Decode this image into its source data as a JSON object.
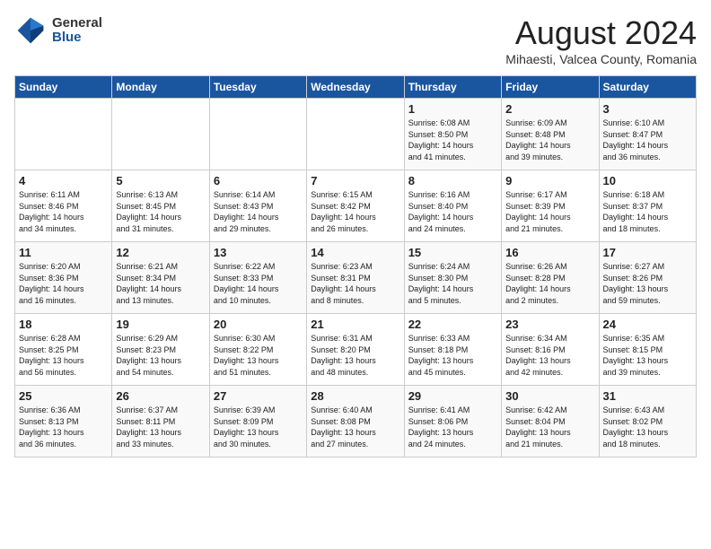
{
  "logo": {
    "general": "General",
    "blue": "Blue"
  },
  "title": {
    "month_year": "August 2024",
    "location": "Mihaesti, Valcea County, Romania"
  },
  "days_of_week": [
    "Sunday",
    "Monday",
    "Tuesday",
    "Wednesday",
    "Thursday",
    "Friday",
    "Saturday"
  ],
  "weeks": [
    [
      {
        "day": "",
        "info": ""
      },
      {
        "day": "",
        "info": ""
      },
      {
        "day": "",
        "info": ""
      },
      {
        "day": "",
        "info": ""
      },
      {
        "day": "1",
        "info": "Sunrise: 6:08 AM\nSunset: 8:50 PM\nDaylight: 14 hours\nand 41 minutes."
      },
      {
        "day": "2",
        "info": "Sunrise: 6:09 AM\nSunset: 8:48 PM\nDaylight: 14 hours\nand 39 minutes."
      },
      {
        "day": "3",
        "info": "Sunrise: 6:10 AM\nSunset: 8:47 PM\nDaylight: 14 hours\nand 36 minutes."
      }
    ],
    [
      {
        "day": "4",
        "info": "Sunrise: 6:11 AM\nSunset: 8:46 PM\nDaylight: 14 hours\nand 34 minutes."
      },
      {
        "day": "5",
        "info": "Sunrise: 6:13 AM\nSunset: 8:45 PM\nDaylight: 14 hours\nand 31 minutes."
      },
      {
        "day": "6",
        "info": "Sunrise: 6:14 AM\nSunset: 8:43 PM\nDaylight: 14 hours\nand 29 minutes."
      },
      {
        "day": "7",
        "info": "Sunrise: 6:15 AM\nSunset: 8:42 PM\nDaylight: 14 hours\nand 26 minutes."
      },
      {
        "day": "8",
        "info": "Sunrise: 6:16 AM\nSunset: 8:40 PM\nDaylight: 14 hours\nand 24 minutes."
      },
      {
        "day": "9",
        "info": "Sunrise: 6:17 AM\nSunset: 8:39 PM\nDaylight: 14 hours\nand 21 minutes."
      },
      {
        "day": "10",
        "info": "Sunrise: 6:18 AM\nSunset: 8:37 PM\nDaylight: 14 hours\nand 18 minutes."
      }
    ],
    [
      {
        "day": "11",
        "info": "Sunrise: 6:20 AM\nSunset: 8:36 PM\nDaylight: 14 hours\nand 16 minutes."
      },
      {
        "day": "12",
        "info": "Sunrise: 6:21 AM\nSunset: 8:34 PM\nDaylight: 14 hours\nand 13 minutes."
      },
      {
        "day": "13",
        "info": "Sunrise: 6:22 AM\nSunset: 8:33 PM\nDaylight: 14 hours\nand 10 minutes."
      },
      {
        "day": "14",
        "info": "Sunrise: 6:23 AM\nSunset: 8:31 PM\nDaylight: 14 hours\nand 8 minutes."
      },
      {
        "day": "15",
        "info": "Sunrise: 6:24 AM\nSunset: 8:30 PM\nDaylight: 14 hours\nand 5 minutes."
      },
      {
        "day": "16",
        "info": "Sunrise: 6:26 AM\nSunset: 8:28 PM\nDaylight: 14 hours\nand 2 minutes."
      },
      {
        "day": "17",
        "info": "Sunrise: 6:27 AM\nSunset: 8:26 PM\nDaylight: 13 hours\nand 59 minutes."
      }
    ],
    [
      {
        "day": "18",
        "info": "Sunrise: 6:28 AM\nSunset: 8:25 PM\nDaylight: 13 hours\nand 56 minutes."
      },
      {
        "day": "19",
        "info": "Sunrise: 6:29 AM\nSunset: 8:23 PM\nDaylight: 13 hours\nand 54 minutes."
      },
      {
        "day": "20",
        "info": "Sunrise: 6:30 AM\nSunset: 8:22 PM\nDaylight: 13 hours\nand 51 minutes."
      },
      {
        "day": "21",
        "info": "Sunrise: 6:31 AM\nSunset: 8:20 PM\nDaylight: 13 hours\nand 48 minutes."
      },
      {
        "day": "22",
        "info": "Sunrise: 6:33 AM\nSunset: 8:18 PM\nDaylight: 13 hours\nand 45 minutes."
      },
      {
        "day": "23",
        "info": "Sunrise: 6:34 AM\nSunset: 8:16 PM\nDaylight: 13 hours\nand 42 minutes."
      },
      {
        "day": "24",
        "info": "Sunrise: 6:35 AM\nSunset: 8:15 PM\nDaylight: 13 hours\nand 39 minutes."
      }
    ],
    [
      {
        "day": "25",
        "info": "Sunrise: 6:36 AM\nSunset: 8:13 PM\nDaylight: 13 hours\nand 36 minutes."
      },
      {
        "day": "26",
        "info": "Sunrise: 6:37 AM\nSunset: 8:11 PM\nDaylight: 13 hours\nand 33 minutes."
      },
      {
        "day": "27",
        "info": "Sunrise: 6:39 AM\nSunset: 8:09 PM\nDaylight: 13 hours\nand 30 minutes."
      },
      {
        "day": "28",
        "info": "Sunrise: 6:40 AM\nSunset: 8:08 PM\nDaylight: 13 hours\nand 27 minutes."
      },
      {
        "day": "29",
        "info": "Sunrise: 6:41 AM\nSunset: 8:06 PM\nDaylight: 13 hours\nand 24 minutes."
      },
      {
        "day": "30",
        "info": "Sunrise: 6:42 AM\nSunset: 8:04 PM\nDaylight: 13 hours\nand 21 minutes."
      },
      {
        "day": "31",
        "info": "Sunrise: 6:43 AM\nSunset: 8:02 PM\nDaylight: 13 hours\nand 18 minutes."
      }
    ]
  ]
}
